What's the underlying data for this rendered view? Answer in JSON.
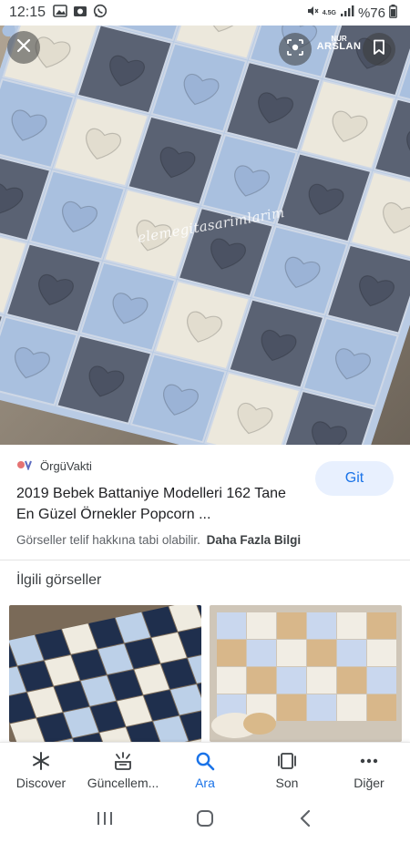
{
  "status_bar": {
    "time": "12:15",
    "network": "4.5G",
    "battery": "%76"
  },
  "hero": {
    "watermark": "elemegitasarimlarim",
    "brand_top": "NUR",
    "brand_bottom": "ARSLAN",
    "icons": [
      "close-icon",
      "lens-icon",
      "bookmark-icon"
    ]
  },
  "result": {
    "source": "ÖrgüVakti",
    "title": "2019 Bebek Battaniye Modelleri 162 Tane En Güzel Örnekler Popcorn ...",
    "visit_label": "Git",
    "copyright": "Görseller telif hakkına tabi olabilir.",
    "more_info": "Daha Fazla Bilgi"
  },
  "related": {
    "heading": "İlgili görseller"
  },
  "bottom_nav": {
    "items": [
      {
        "label": "Discover",
        "icon": "asterisk-icon"
      },
      {
        "label": "Güncellem...",
        "icon": "updates-icon"
      },
      {
        "label": "Ara",
        "icon": "search-icon"
      },
      {
        "label": "Son",
        "icon": "recent-icon"
      },
      {
        "label": "Diğer",
        "icon": "more-icon"
      }
    ],
    "active_color": "#1a73e8"
  },
  "colors": {
    "accent": "#1a73e8",
    "blanket_dark": "#5a6273",
    "blanket_light_blue": "#a9c0df",
    "blanket_cream": "#ece8dc"
  }
}
